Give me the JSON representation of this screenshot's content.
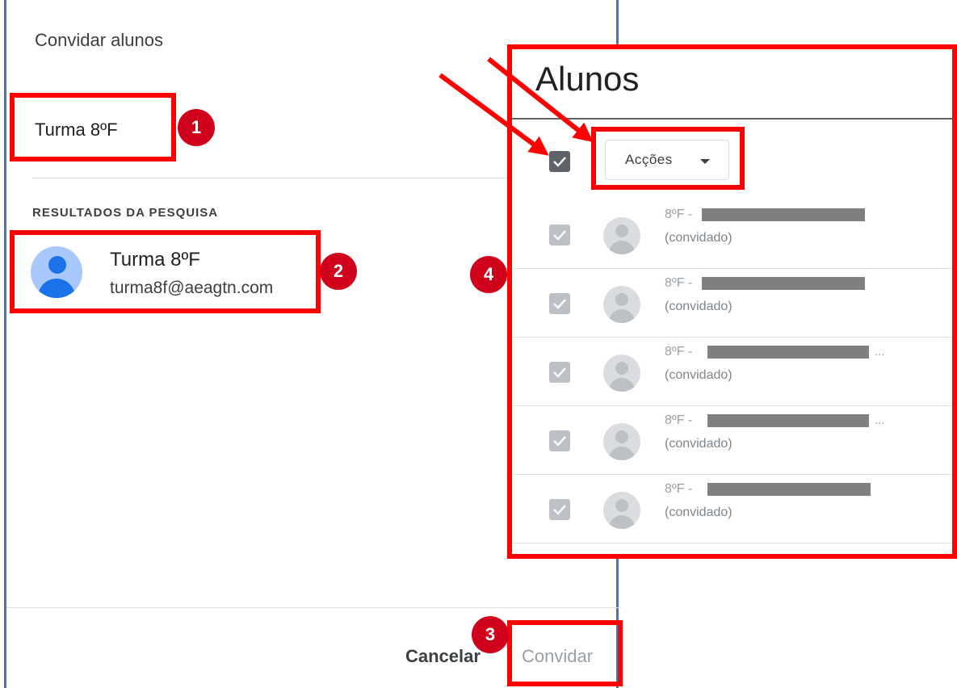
{
  "dialog": {
    "title": "Convidar alunos",
    "search_value": "Turma 8ºF",
    "results_header": "RESULTADOS DA PESQUISA",
    "result": {
      "name": "Turma 8ºF",
      "email": "turma8f@aeagtn.com"
    },
    "cancel_label": "Cancelar",
    "invite_label": "Convidar"
  },
  "panel": {
    "title": "Alunos",
    "actions_label": "Acções",
    "rows": [
      {
        "prefix": "8ºF -",
        "status": "(convidado)"
      },
      {
        "prefix": "8ºF -",
        "status": "(convidado)"
      },
      {
        "prefix": "8ºF -",
        "status": "(convidado)",
        "ellipsis": "..."
      },
      {
        "prefix": "8ºF -",
        "status": "(convidado)",
        "ellipsis": "..."
      },
      {
        "prefix": "8ºF -",
        "status": "(convidado)"
      }
    ]
  },
  "annotations": {
    "badges": [
      "1",
      "2",
      "3",
      "4"
    ],
    "highlight_color": "#ff0000",
    "badge_color": "#d0021b"
  },
  "colors": {
    "dialog_border": "#4a73b8",
    "accent_blue": "#1a73e8"
  }
}
